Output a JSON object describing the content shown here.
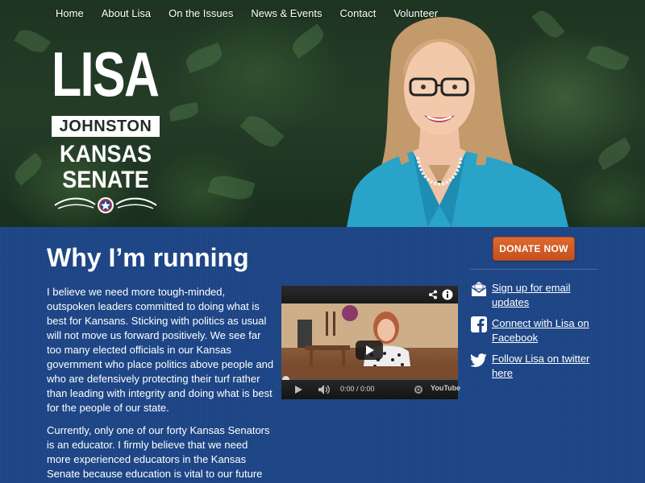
{
  "nav": {
    "items": [
      {
        "label": "Home"
      },
      {
        "label": "About Lisa"
      },
      {
        "label": "On the Issues"
      },
      {
        "label": "News & Events"
      },
      {
        "label": "Contact"
      },
      {
        "label": "Volunteer"
      }
    ]
  },
  "logo": {
    "first_name": "LISA",
    "last_name": "JOHNSTON",
    "office_line1": "KANSAS",
    "office_line2": "SENATE",
    "emblem_icon": "star-icon"
  },
  "main": {
    "title": "Why I’m running",
    "paragraphs": [
      "I believe we need more tough-minded, outspoken leaders committed to doing what is best for Kansans. Sticking with politics as usual will not move us forward positively. We see far too many elected officials in our Kansas government who place politics above people and who are defensively protecting their turf rather than leading with integrity and doing what is best for the people of our state.",
      "Currently, only one of our forty Kansas Senators is an educator. I firmly believe that we need more experienced educators in the Kansas Senate because education is vital to our future and must"
    ]
  },
  "video": {
    "time": "0:00 / 0:00",
    "brand": "YouTube",
    "progress": 0,
    "icons": [
      "share-icon",
      "info-icon",
      "play-icon",
      "volume-icon",
      "settings-icon"
    ]
  },
  "sidebar": {
    "donate_label": "DONATE NOW",
    "links": [
      {
        "label": "Sign up for email updates",
        "icon": "mail-icon"
      },
      {
        "label": "Connect with Lisa on Facebook",
        "icon": "facebook-icon"
      },
      {
        "label": "Follow Lisa on twitter here",
        "icon": "twitter-icon"
      }
    ]
  },
  "colors": {
    "main_bg": "#1d4585",
    "donate": "#d25e26",
    "jacket": "#2aa3c9"
  }
}
